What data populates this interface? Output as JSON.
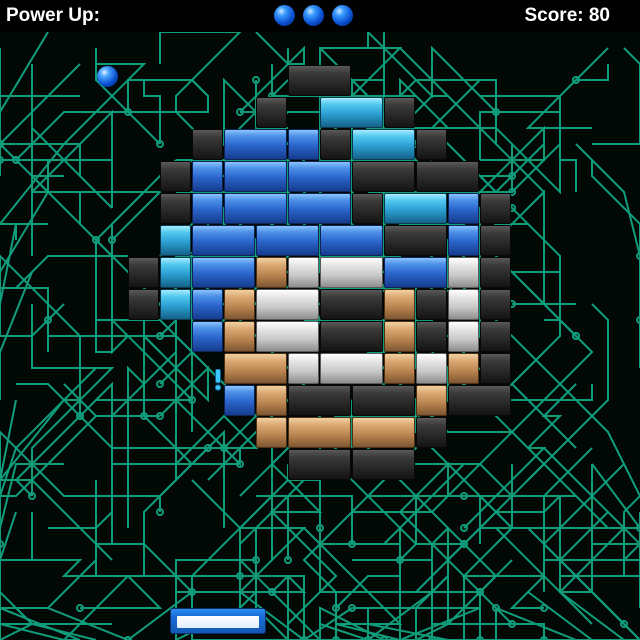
{
  "hud": {
    "powerup_label": "Power Up:",
    "score_label": "Score: 80",
    "lives_remaining": 3
  },
  "colors": {
    "blue": "#3a7fe0",
    "cyan": "#3ab8e6",
    "silver": "#d8d8d8",
    "tan": "#c9925c",
    "dark": "#333333",
    "circuit": "#13b890",
    "paddle": "#1a6fd8"
  },
  "bricks": {
    "blocks": [
      [
        "dark",
        9,
        0,
        2
      ],
      [
        "cyan",
        10,
        1,
        2
      ],
      [
        "dark",
        8,
        1,
        1
      ],
      [
        "dark",
        12,
        1,
        1
      ],
      [
        "dark",
        6,
        2,
        1
      ],
      [
        "blue",
        7,
        2,
        2
      ],
      [
        "blue",
        9,
        2,
        1
      ],
      [
        "dark",
        10,
        2,
        1
      ],
      [
        "cyan",
        11,
        2,
        2
      ],
      [
        "dark",
        13,
        2,
        1
      ],
      [
        "dark",
        5,
        3,
        1
      ],
      [
        "blue",
        6,
        3,
        1
      ],
      [
        "blue",
        7,
        3,
        2
      ],
      [
        "blue",
        9,
        3,
        2
      ],
      [
        "dark",
        11,
        3,
        2
      ],
      [
        "dark",
        13,
        3,
        2
      ],
      [
        "dark",
        5,
        4,
        1
      ],
      [
        "blue",
        6,
        4,
        1
      ],
      [
        "blue",
        7,
        4,
        2
      ],
      [
        "blue",
        9,
        4,
        2
      ],
      [
        "dark",
        11,
        4,
        1
      ],
      [
        "cyan",
        12,
        4,
        2
      ],
      [
        "blue",
        14,
        4,
        1
      ],
      [
        "dark",
        15,
        4,
        1
      ],
      [
        "cyan",
        5,
        5,
        1
      ],
      [
        "blue",
        6,
        5,
        2
      ],
      [
        "blue",
        8,
        5,
        2
      ],
      [
        "blue",
        10,
        5,
        2
      ],
      [
        "dark",
        12,
        5,
        2
      ],
      [
        "blue",
        14,
        5,
        1
      ],
      [
        "dark",
        15,
        5,
        1
      ],
      [
        "dark",
        4,
        6,
        1
      ],
      [
        "cyan",
        5,
        6,
        1
      ],
      [
        "blue",
        6,
        6,
        2
      ],
      [
        "tan",
        8,
        6,
        1
      ],
      [
        "silver",
        9,
        6,
        1
      ],
      [
        "silver",
        10,
        6,
        2
      ],
      [
        "blue",
        12,
        6,
        2
      ],
      [
        "silver",
        14,
        6,
        1
      ],
      [
        "dark",
        15,
        6,
        1
      ],
      [
        "dark",
        4,
        7,
        1
      ],
      [
        "cyan",
        5,
        7,
        1
      ],
      [
        "blue",
        6,
        7,
        1
      ],
      [
        "tan",
        7,
        7,
        1
      ],
      [
        "silver",
        8,
        7,
        2
      ],
      [
        "dark",
        10,
        7,
        2
      ],
      [
        "tan",
        12,
        7,
        1
      ],
      [
        "dark",
        13,
        7,
        1
      ],
      [
        "silver",
        14,
        7,
        1
      ],
      [
        "dark",
        15,
        7,
        1
      ],
      [
        "blue",
        6,
        8,
        1
      ],
      [
        "tan",
        7,
        8,
        1
      ],
      [
        "silver",
        8,
        8,
        2
      ],
      [
        "dark",
        10,
        8,
        2
      ],
      [
        "tan",
        12,
        8,
        1
      ],
      [
        "dark",
        13,
        8,
        1
      ],
      [
        "silver",
        14,
        8,
        1
      ],
      [
        "dark",
        15,
        8,
        1
      ],
      [
        "tan",
        7,
        9,
        2
      ],
      [
        "silver",
        9,
        9,
        1
      ],
      [
        "silver",
        10,
        9,
        2
      ],
      [
        "tan",
        12,
        9,
        1
      ],
      [
        "silver",
        13,
        9,
        1
      ],
      [
        "tan",
        14,
        9,
        1
      ],
      [
        "dark",
        15,
        9,
        1
      ],
      [
        "blue",
        7,
        10,
        1
      ],
      [
        "tan",
        8,
        10,
        1
      ],
      [
        "dark",
        9,
        10,
        2
      ],
      [
        "dark",
        11,
        10,
        2
      ],
      [
        "tan",
        13,
        10,
        1
      ],
      [
        "dark",
        14,
        10,
        2
      ],
      [
        "tan",
        8,
        11,
        1
      ],
      [
        "tan",
        9,
        11,
        2
      ],
      [
        "tan",
        11,
        11,
        2
      ],
      [
        "dark",
        13,
        11,
        1
      ],
      [
        "dark",
        9,
        12,
        2
      ],
      [
        "dark",
        11,
        12,
        2
      ]
    ]
  },
  "ball": {
    "icon": "ball-icon"
  },
  "powerup": {
    "icon": "exclamation-powerup-icon"
  },
  "paddle": {
    "icon": "paddle"
  }
}
